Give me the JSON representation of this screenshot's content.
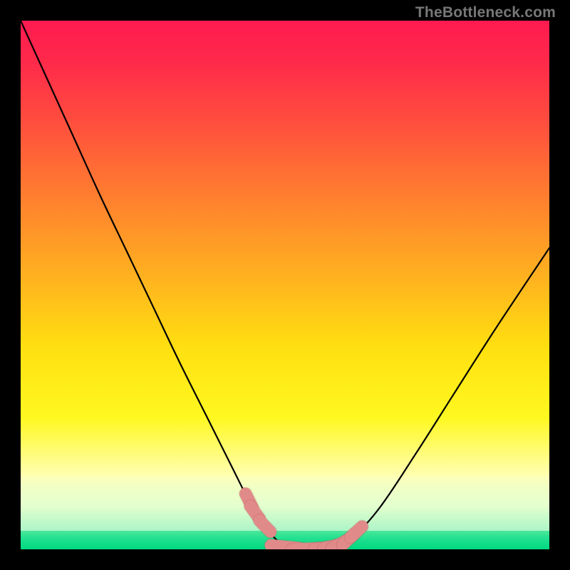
{
  "watermark": "TheBottleneck.com",
  "colors": {
    "frame": "#000000",
    "curve": "#000000",
    "marker_fill": "#e08a8a",
    "marker_stroke": "#b84a4a",
    "gradient_top": "#ff1a50",
    "gradient_bottom": "#00d880"
  },
  "chart_data": {
    "type": "line",
    "title": "",
    "xlabel": "",
    "ylabel": "",
    "xlim": [
      0,
      100
    ],
    "ylim": [
      0,
      100
    ],
    "grid": false,
    "legend": false,
    "annotations": [],
    "series": [
      {
        "name": "bottleneck-curve",
        "x": [
          0,
          5,
          10,
          15,
          20,
          25,
          30,
          35,
          40,
          43,
          45,
          48,
          50,
          52,
          55,
          58,
          60,
          63,
          68,
          75,
          82,
          90,
          100
        ],
        "y": [
          100,
          89,
          78,
          67,
          56.5,
          46,
          35.5,
          25.5,
          15.5,
          9.5,
          5.8,
          2.2,
          0.6,
          0,
          0,
          0.3,
          0.8,
          2.5,
          8,
          18.5,
          29.5,
          42,
          57
        ]
      }
    ],
    "markers": {
      "name": "highlight-segment",
      "x": [
        43.2,
        44.3,
        46.2,
        50.0,
        54.0,
        57.0,
        58.8,
        60.2,
        62.0,
        63.5
      ],
      "y": [
        9.2,
        7.0,
        4.4,
        0.5,
        0.1,
        0.25,
        0.55,
        0.9,
        1.9,
        3.3
      ]
    }
  }
}
